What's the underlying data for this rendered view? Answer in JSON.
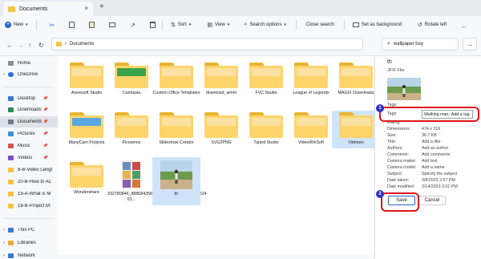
{
  "window": {
    "tab_title": "Documents",
    "new_tab_glyph": "+",
    "close_glyph": "×"
  },
  "toolbar": {
    "new": "New",
    "sort": "Sort",
    "view": "View",
    "search_options": "Search options",
    "close_search": "Close search",
    "set_background": "Set as background",
    "rotate_left": "Rotate left",
    "more": "..."
  },
  "addressbar": {
    "path": "Documents",
    "search_value": "wallpaper boy"
  },
  "sidebar": {
    "items": [
      {
        "label": "Home",
        "icon": "home-icon"
      },
      {
        "label": "OneDrive",
        "icon": "cloud-icon"
      },
      {
        "label": "Desktop",
        "icon": "desktop-icon"
      },
      {
        "label": "Downloads",
        "icon": "download-icon"
      },
      {
        "label": "Documents",
        "icon": "document-icon"
      },
      {
        "label": "Pictures",
        "icon": "picture-icon"
      },
      {
        "label": "Music",
        "icon": "music-icon"
      },
      {
        "label": "Videos",
        "icon": "video-icon"
      },
      {
        "label": "8-B-Video Lengt",
        "icon": "folder-icon"
      },
      {
        "label": "20-B-How to Ac",
        "icon": "folder-icon"
      },
      {
        "label": "19-A-What is M",
        "icon": "folder-icon"
      },
      {
        "label": "18-B-Project M:",
        "icon": "folder-icon"
      },
      {
        "label": "This PC",
        "icon": "pc-icon"
      },
      {
        "label": "Libraries",
        "icon": "library-icon"
      },
      {
        "label": "Network",
        "icon": "network-icon"
      }
    ]
  },
  "files": [
    {
      "name": "Aiseesoft Studio"
    },
    {
      "name": "Camtasia"
    },
    {
      "name": "Custom Office Templates"
    },
    {
      "name": "download_wmm"
    },
    {
      "name": "FVC Studio"
    },
    {
      "name": "League of Legends"
    },
    {
      "name": "MAGIX Downloads"
    },
    {
      "name": "ManyCam Projects"
    },
    {
      "name": "Picosmos"
    },
    {
      "name": "Slideshow Creator"
    },
    {
      "name": "SVG2PNG"
    },
    {
      "name": "Tipard Studio"
    },
    {
      "name": "VideoWinSoft"
    },
    {
      "name": "Vidmore"
    },
    {
      "name": "Wondershare"
    },
    {
      "name": "332780846_888684358913184_5668965422034524 61..."
    },
    {
      "name": "th"
    }
  ],
  "details": {
    "title": "th",
    "type": "JFIF File",
    "rows": [
      {
        "k": "Tags:",
        "v": "Walking man; Add a tag"
      },
      {
        "k": "Rating:",
        "v": ""
      },
      {
        "k": "Dimensions:",
        "v": "474 x 316"
      },
      {
        "k": "Size:",
        "v": "36.7 KB"
      },
      {
        "k": "Title:",
        "v": "Add a title"
      },
      {
        "k": "Authors:",
        "v": "Add an author"
      },
      {
        "k": "Comments:",
        "v": "Add comments"
      },
      {
        "k": "Camera maker:",
        "v": "Add text"
      },
      {
        "k": "Camera model:",
        "v": "Add a name"
      },
      {
        "k": "Subject:",
        "v": "Specify the subject"
      },
      {
        "k": "Date taken:",
        "v": "3/8/2023 2:57 PM"
      },
      {
        "k": "Date modified:",
        "v": "3/14/2023 3:01 PM"
      }
    ],
    "tags_value": "Walking man",
    "tags_hint": "Add a tag",
    "save": "Save",
    "cancel": "Cancel",
    "marker1": "1",
    "marker2": "2",
    "highlight_color": "#e0151b",
    "marker_color": "#2a33c9"
  }
}
